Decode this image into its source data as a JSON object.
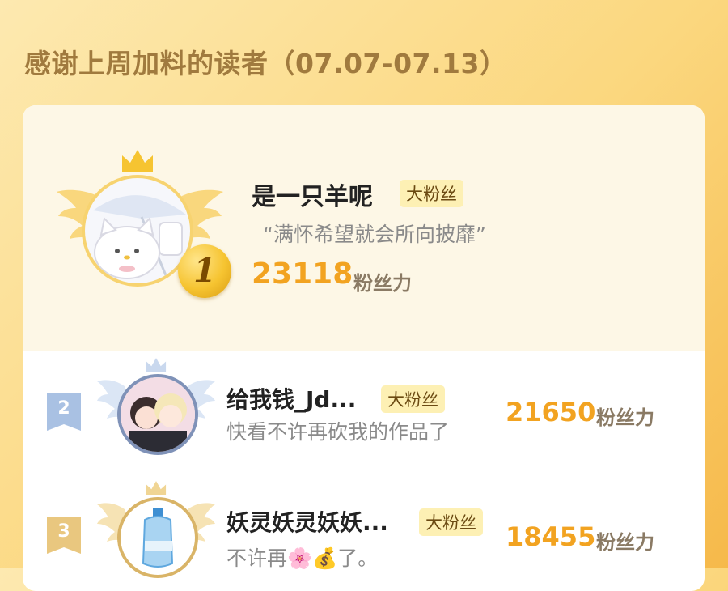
{
  "header": {
    "title": "感谢上周加料的读者（07.07-07.13）"
  },
  "colors": {
    "accent": "#f2a321",
    "badge_bg": "#fdf0b4",
    "gold": "#f6c431"
  },
  "ranking": [
    {
      "rank": "1",
      "name": "是一只羊呢",
      "badge": "大粉丝",
      "motto": "“满怀希望就会所向披靡”",
      "score": "23118",
      "unit": "粉丝力",
      "avatar_icon": "white-cat-umbrella-avatar"
    },
    {
      "rank": "2",
      "name": "给我钱_Jd...",
      "badge": "大粉丝",
      "motto": "快看不许再砍我的作品了",
      "score": "21650",
      "unit": "粉丝力",
      "avatar_icon": "anime-couple-avatar"
    },
    {
      "rank": "3",
      "name": "妖灵妖灵妖妖...",
      "badge": "大粉丝",
      "motto": "不许再🌸💰了。",
      "score": "18455",
      "unit": "粉丝力",
      "avatar_icon": "water-bottle-avatar"
    }
  ]
}
